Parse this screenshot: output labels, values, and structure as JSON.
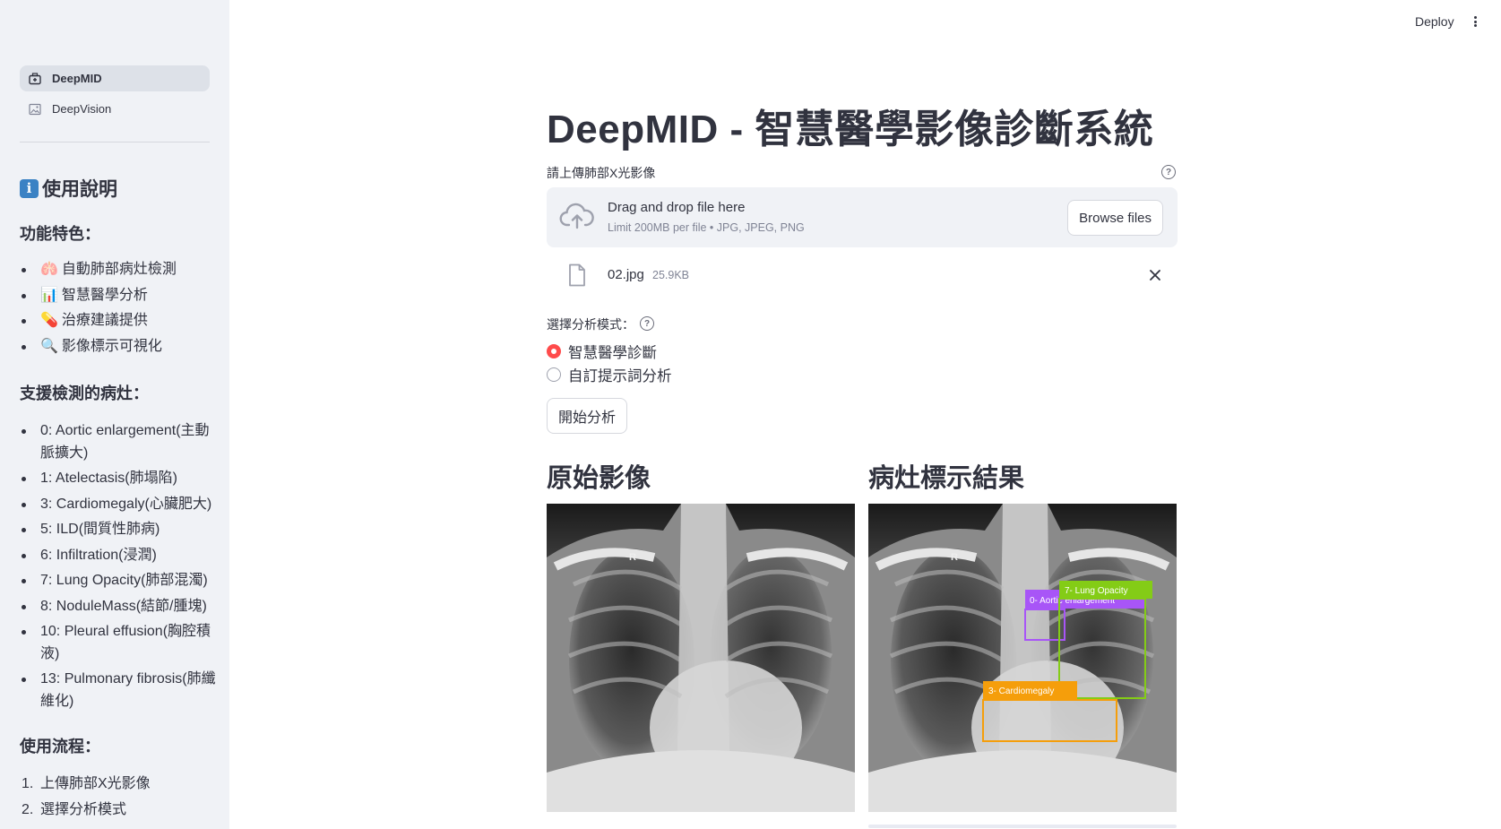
{
  "header": {
    "deploy_label": "Deploy"
  },
  "sidebar": {
    "nav": [
      {
        "label": "DeepMID",
        "icon": "briefcase-medical-icon",
        "active": true
      },
      {
        "label": "DeepVision",
        "icon": "image-icon",
        "active": false
      }
    ],
    "heading": "使用說明",
    "heading_icon": "info-icon",
    "features_title": "功能特色：",
    "features": [
      {
        "emoji": "🫁",
        "text": "自動肺部病灶檢測"
      },
      {
        "emoji": "📊",
        "text": "智慧醫學分析"
      },
      {
        "emoji": "💊",
        "text": "治療建議提供"
      },
      {
        "emoji": "🔍",
        "text": "影像標示可視化"
      }
    ],
    "lesions_title": "支援檢測的病灶：",
    "lesions": [
      "0: Aortic enlargement(主動脈擴大)",
      "1: Atelectasis(肺塌陷)",
      "3: Cardiomegaly(心臟肥大)",
      "5: ILD(間質性肺病)",
      "6: Infiltration(浸潤)",
      "7: Lung Opacity(肺部混濁)",
      "8: NoduleMass(結節/腫塊)",
      "10: Pleural effusion(胸腔積液)",
      "13: Pulmonary fibrosis(肺纖維化)"
    ],
    "flow_title": "使用流程：",
    "flow": [
      {
        "num": "1.",
        "text": "上傳肺部X光影像"
      },
      {
        "num": "2.",
        "text": "選擇分析模式"
      }
    ]
  },
  "main": {
    "title": "DeepMID - 智慧醫學影像診斷系統",
    "upload_label": "請上傳肺部X光影像",
    "dropzone_main": "Drag and drop file here",
    "dropzone_limit": "Limit 200MB per file • JPG, JPEG, PNG",
    "browse_label": "Browse files",
    "file_name": "02.jpg",
    "file_size": "25.9KB",
    "mode_label": "選擇分析模式：",
    "modes": [
      {
        "label": "智慧醫學診斷",
        "selected": true
      },
      {
        "label": "自訂提示詞分析",
        "selected": false
      }
    ],
    "start_label": "開始分析",
    "original_title": "原始影像",
    "result_title": "病灶標示結果",
    "image_marker": "R",
    "detections": [
      {
        "label": "0- Aortic enlargement",
        "color": "#a855f7"
      },
      {
        "label": "7- Lung Opacity",
        "color": "#84cc16"
      },
      {
        "label": "3- Cardiomegaly",
        "color": "#f59e0b"
      }
    ]
  },
  "colors": {
    "accent": "#ff4b4b",
    "sidebar_bg": "#f0f2f6"
  }
}
